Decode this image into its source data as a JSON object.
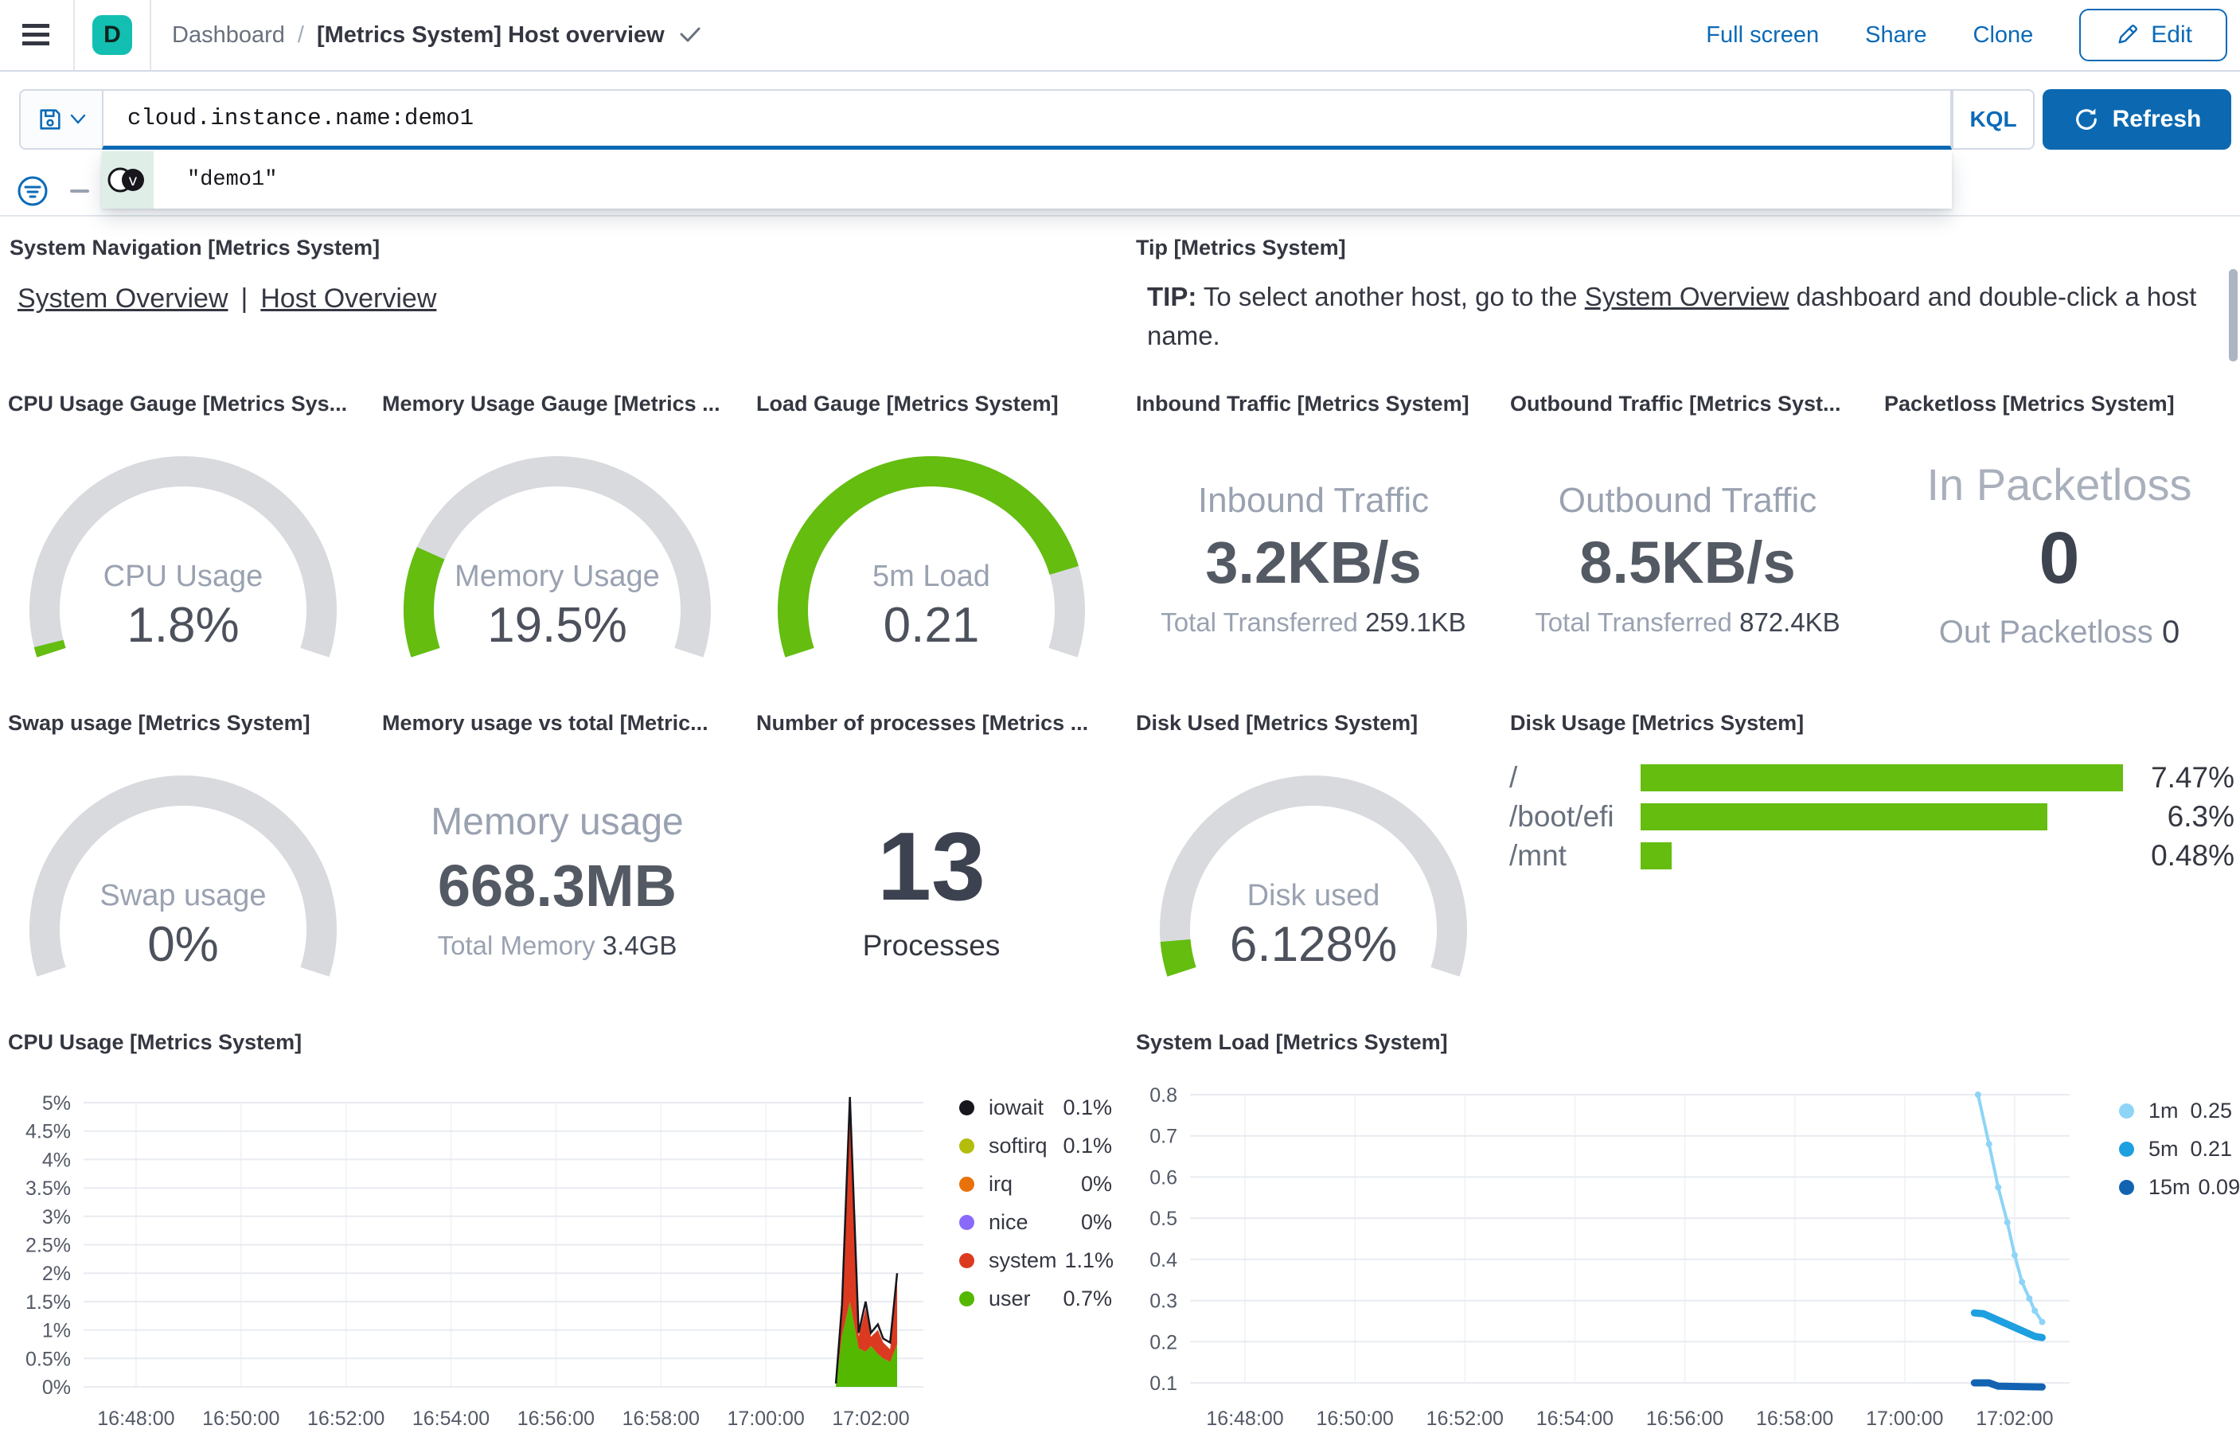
{
  "header": {
    "space_initial": "D",
    "breadcrumb_root": "Dashboard",
    "breadcrumb_sep": "/",
    "title": "[Metrics System] Host overview",
    "actions": {
      "full_screen": "Full screen",
      "share": "Share",
      "clone": "Clone",
      "edit": "Edit"
    }
  },
  "query_bar": {
    "query": "cloud.instance.name:demo1",
    "language_label": "KQL",
    "refresh_label": "Refresh",
    "add_filter_label": "+"
  },
  "suggestion": {
    "text": "\"demo1\""
  },
  "panels": {
    "system_navigation": {
      "title": "System Navigation [Metrics System]",
      "link1": "System Overview",
      "divider": "|",
      "link2": "Host Overview"
    },
    "tip": {
      "title": "Tip [Metrics System]",
      "bold": "TIP:",
      "pre": " To select another host, go to the ",
      "link": "System Overview",
      "post": " dashboard and double-click a host name."
    },
    "cpu_gauge": {
      "title": "CPU Usage Gauge [Metrics Sys...",
      "label": "CPU Usage",
      "value": "1.8%",
      "fraction": 0.018
    },
    "memory_gauge": {
      "title": "Memory Usage Gauge [Metrics ...",
      "label": "Memory Usage",
      "value": "19.5%",
      "fraction": 0.195
    },
    "load_gauge": {
      "title": "Load Gauge [Metrics System]",
      "label": "5m Load",
      "value": "0.21",
      "fraction": 0.84
    },
    "inbound": {
      "title": "Inbound Traffic [Metrics System]",
      "label": "Inbound Traffic",
      "value": "3.2KB/s",
      "sub_label": "Total Transferred",
      "sub_value": "259.1KB"
    },
    "outbound": {
      "title": "Outbound Traffic [Metrics Syst...",
      "label": "Outbound Traffic",
      "value": "8.5KB/s",
      "sub_label": "Total Transferred",
      "sub_value": "872.4KB"
    },
    "packetloss": {
      "title": "Packetloss [Metrics System]",
      "label": "In Packetloss",
      "value": "0",
      "sub_label": "Out Packetloss",
      "sub_value": "0"
    },
    "swap_gauge": {
      "title": "Swap usage [Metrics System]",
      "label": "Swap usage",
      "value": "0%",
      "fraction": 0
    },
    "memory_total": {
      "title": "Memory usage vs total [Metric...",
      "label": "Memory usage",
      "value": "668.3MB",
      "sub_label": "Total Memory",
      "sub_value": "3.4GB"
    },
    "processes": {
      "title": "Number of processes [Metrics ...",
      "value": "13",
      "label": "Processes"
    },
    "disk_used_gauge": {
      "title": "Disk Used [Metrics System]",
      "label": "Disk used",
      "value": "6.128%",
      "fraction": 0.0613
    }
  },
  "colors": {
    "gauge_green": "#64BD0F",
    "gauge_gray": "#D9DADE",
    "bar_green": "#64BD0F",
    "primary_blue": "#0B6AB7",
    "teal": "#12BFB1"
  },
  "chart_data": [
    {
      "id": "disk_usage",
      "type": "bar",
      "title": "Disk Usage [Metrics System]",
      "orientation": "horizontal",
      "categories": [
        "/",
        "/boot/efi",
        "/mnt"
      ],
      "values": [
        7.47,
        6.3,
        0.48
      ],
      "value_labels": [
        "7.47%",
        "6.3%",
        "0.48%"
      ],
      "xlim": [
        0,
        7.47
      ],
      "bar_color": "#64BD0F"
    },
    {
      "id": "cpu_usage",
      "type": "area",
      "stacked": true,
      "title": "CPU Usage [Metrics System]",
      "x_domain": [
        "16:47:00",
        "17:03:00"
      ],
      "x_ticks": [
        "16:48:00",
        "16:50:00",
        "16:52:00",
        "16:54:00",
        "16:56:00",
        "16:58:00",
        "17:00:00",
        "17:02:00"
      ],
      "y_ticks": [
        "0%",
        "0.5%",
        "1%",
        "1.5%",
        "2%",
        "2.5%",
        "3%",
        "3.5%",
        "4%",
        "4.5%",
        "5%"
      ],
      "ylim": [
        0,
        5
      ],
      "times": [
        "17:01:20",
        "17:01:27",
        "17:01:36",
        "17:01:46",
        "17:01:54",
        "17:02:00",
        "17:02:08",
        "17:02:14",
        "17:02:22",
        "17:02:30"
      ],
      "series": [
        {
          "name": "user",
          "role": "area_base",
          "color": "#54B700",
          "values": [
            0.03,
            0.9,
            1.5,
            0.68,
            0.62,
            0.72,
            0.58,
            0.5,
            0.44,
            0.75
          ]
        },
        {
          "name": "system",
          "role": "area_between",
          "color": "#DB3A20",
          "values_top": [
            0.05,
            1.35,
            4.85,
            0.88,
            1.38,
            0.88,
            1.0,
            0.78,
            0.66,
            1.85
          ]
        },
        {
          "name": "total",
          "role": "line",
          "color": "#16161C",
          "values": [
            0.06,
            1.45,
            5.1,
            0.95,
            1.5,
            0.95,
            1.1,
            0.85,
            0.78,
            2.0
          ]
        }
      ],
      "legend": [
        {
          "label": "iowait",
          "value": "0.1%",
          "color": "#16161C"
        },
        {
          "label": "softirq",
          "value": "0.1%",
          "color": "#B4BD0B"
        },
        {
          "label": "irq",
          "value": "0%",
          "color": "#E8710A"
        },
        {
          "label": "nice",
          "value": "0%",
          "color": "#8A6AFB"
        },
        {
          "label": "system",
          "value": "1.1%",
          "color": "#DB3A20"
        },
        {
          "label": "user",
          "value": "0.7%",
          "color": "#54B700"
        }
      ]
    },
    {
      "id": "system_load",
      "type": "line",
      "title": "System Load [Metrics System]",
      "x_domain": [
        "16:47:00",
        "17:03:00"
      ],
      "x_ticks": [
        "16:48:00",
        "16:50:00",
        "16:52:00",
        "16:54:00",
        "16:56:00",
        "16:58:00",
        "17:00:00",
        "17:02:00"
      ],
      "y_ticks": [
        "0.1",
        "0.2",
        "0.3",
        "0.4",
        "0.5",
        "0.6",
        "0.7",
        "0.8"
      ],
      "ylim": [
        0.1,
        0.8
      ],
      "series": [
        {
          "name": "1m",
          "color": "#8ED4F7",
          "width": 4,
          "marker": true,
          "points": [
            [
              "17:01:20",
              0.8
            ],
            [
              "17:01:32",
              0.68
            ],
            [
              "17:01:42",
              0.575
            ],
            [
              "17:01:52",
              0.49
            ],
            [
              "17:02:00",
              0.41
            ],
            [
              "17:02:08",
              0.345
            ],
            [
              "17:02:16",
              0.305
            ],
            [
              "17:02:22",
              0.275
            ],
            [
              "17:02:30",
              0.248
            ]
          ]
        },
        {
          "name": "5m",
          "color": "#1E9FE0",
          "width": 9,
          "points": [
            [
              "17:01:16",
              0.27
            ],
            [
              "17:01:26",
              0.268
            ],
            [
              "17:02:22",
              0.213
            ],
            [
              "17:02:30",
              0.21
            ]
          ]
        },
        {
          "name": "15m",
          "color": "#1263B2",
          "width": 9,
          "points": [
            [
              "17:01:16",
              0.1
            ],
            [
              "17:01:32",
              0.1
            ],
            [
              "17:01:42",
              0.092
            ],
            [
              "17:02:30",
              0.09
            ]
          ]
        }
      ],
      "legend": [
        {
          "label": "1m",
          "value": "0.25",
          "color": "#8ED4F7"
        },
        {
          "label": "5m",
          "value": "0.21",
          "color": "#1E9FE0"
        },
        {
          "label": "15m",
          "value": "0.09",
          "color": "#1263B2"
        }
      ]
    }
  ]
}
